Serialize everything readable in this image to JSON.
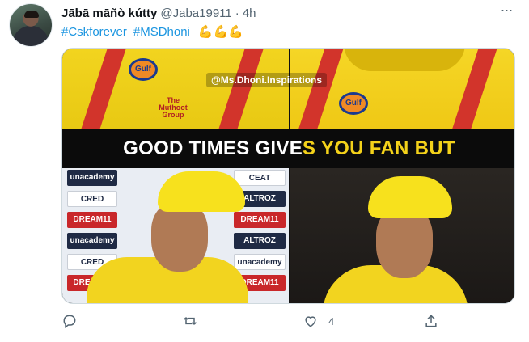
{
  "tweet": {
    "display_name": "Jābā māñò kútty",
    "handle": "@Jaba19911",
    "separator": "·",
    "time": "4h",
    "more_label": "···",
    "hashtags": [
      "#Cskforever",
      "#MSDhoni"
    ],
    "emojis": "💪💪💪"
  },
  "media": {
    "watermark": "@Ms.Dhoni.Inspirations",
    "caption_white": "GOOD TIMES GIVE",
    "caption_yellow": "S YOU FAN BUT",
    "sponsors_left": [
      "unacademy",
      "CRED",
      "DREAM11",
      "unacademy",
      "CRED",
      "DREAM11"
    ],
    "sponsors_right": [
      "CEAT",
      "ALTROZ",
      "DREAM11",
      "ALTROZ",
      "unacademy",
      "DREAM11"
    ],
    "jersey_logos": [
      "Gulf",
      "The Muthoot Group"
    ]
  },
  "actions": {
    "reply_count": "",
    "retweet_count": "",
    "like_count": "4",
    "share_count": ""
  },
  "colors": {
    "accent_blue": "#1b95e0",
    "muted_gray": "#536471",
    "csk_yellow": "#f4d21a"
  }
}
